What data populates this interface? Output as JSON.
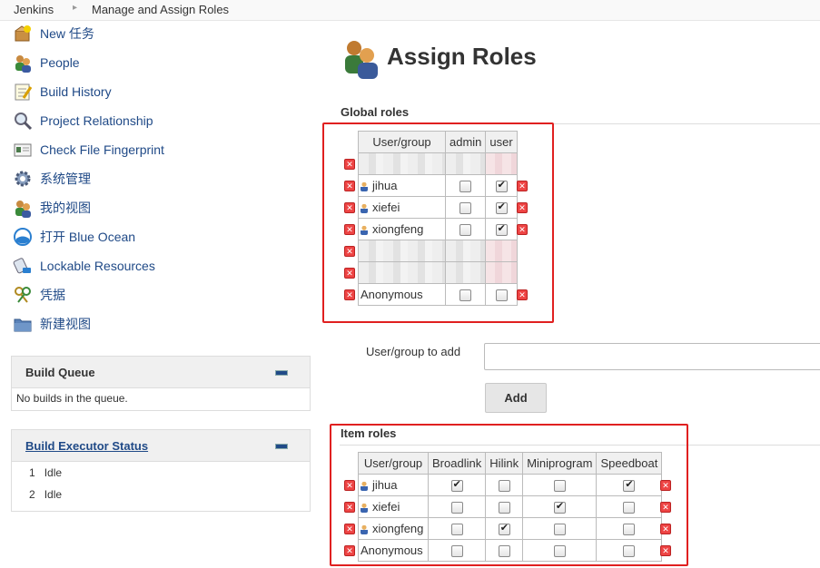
{
  "breadcrumb": {
    "items": [
      "Jenkins",
      "Manage and Assign Roles"
    ]
  },
  "sidebar": {
    "items": [
      {
        "label": "New 任务",
        "icon": "new-task-icon"
      },
      {
        "label": "People",
        "icon": "people-icon"
      },
      {
        "label": "Build History",
        "icon": "build-history-icon"
      },
      {
        "label": "Project Relationship",
        "icon": "magnifier-icon"
      },
      {
        "label": "Check File Fingerprint",
        "icon": "fingerprint-icon"
      },
      {
        "label": "系统管理",
        "icon": "gear-icon"
      },
      {
        "label": "我的视图",
        "icon": "people-icon"
      },
      {
        "label": "打开 Blue Ocean",
        "icon": "blue-ocean-icon"
      },
      {
        "label": "Lockable Resources",
        "icon": "lock-resource-icon"
      },
      {
        "label": "凭据",
        "icon": "credentials-icon"
      },
      {
        "label": "新建视图",
        "icon": "folder-icon"
      }
    ]
  },
  "build_queue": {
    "title": "Build Queue",
    "empty_text": "No builds in the queue."
  },
  "executor_status": {
    "title": "Build Executor Status",
    "executors": [
      {
        "num": "1",
        "state": "Idle"
      },
      {
        "num": "2",
        "state": "Idle"
      }
    ]
  },
  "page": {
    "title": "Assign Roles"
  },
  "global_roles": {
    "title": "Global roles",
    "columns": [
      "User/group",
      "admin",
      "user"
    ],
    "rows": [
      {
        "name": "jihua",
        "checks": [
          false,
          true
        ],
        "user_icon": true
      },
      {
        "name": "xiefei",
        "checks": [
          false,
          true
        ],
        "user_icon": true
      },
      {
        "name": "xiongfeng",
        "checks": [
          false,
          true
        ],
        "user_icon": true
      },
      {
        "name": "Anonymous",
        "checks": [
          false,
          false
        ],
        "user_icon": false
      }
    ]
  },
  "add_user": {
    "label": "User/group to add",
    "value": "",
    "button": "Add"
  },
  "item_roles": {
    "title": "Item roles",
    "columns": [
      "User/group",
      "Broadlink",
      "Hilink",
      "Miniprogram",
      "Speedboat"
    ],
    "rows": [
      {
        "name": "jihua",
        "checks": [
          true,
          false,
          false,
          true
        ],
        "user_icon": true
      },
      {
        "name": "xiefei",
        "checks": [
          false,
          false,
          true,
          false
        ],
        "user_icon": true
      },
      {
        "name": "xiongfeng",
        "checks": [
          false,
          true,
          false,
          false
        ],
        "user_icon": true
      },
      {
        "name": "Anonymous",
        "checks": [
          false,
          false,
          false,
          false
        ],
        "user_icon": false
      }
    ]
  },
  "colors": {
    "link": "#204a87",
    "highlight_box": "#e02020",
    "delete": "#e44444"
  }
}
